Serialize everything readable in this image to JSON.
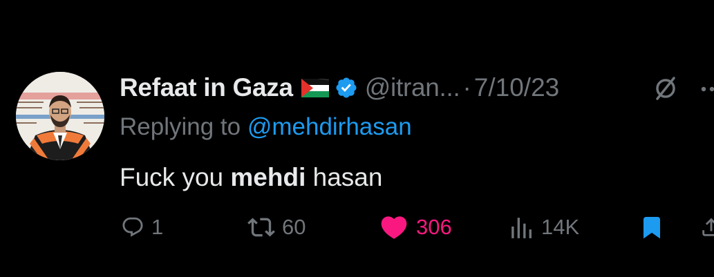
{
  "tweet": {
    "display_name": "Refaat in Gaza",
    "handle": "@itran...",
    "separator": "·",
    "date": "7/10/23",
    "replying_prefix": "Replying to ",
    "replying_mention": "@mehdirhasan",
    "text_before": "Fuck you ",
    "text_bold": "mehdi",
    "text_after": " hasan"
  },
  "actions": {
    "replies": "1",
    "retweets": "60",
    "likes": "306",
    "views": "14K"
  },
  "icons": {
    "flag": "palestine-flag-emoji",
    "verified": "verified-badge-icon",
    "grok": "grok-icon",
    "more": "more-icon",
    "reply": "reply-icon",
    "retweet": "retweet-icon",
    "like": "heart-icon",
    "views": "views-icon",
    "bookmark": "bookmark-icon",
    "share": "share-icon"
  },
  "colors": {
    "background": "#000000",
    "text_primary": "#e7e9ea",
    "text_secondary": "#71767b",
    "accent_blue": "#1d9bf0",
    "like_pink": "#f91880"
  }
}
